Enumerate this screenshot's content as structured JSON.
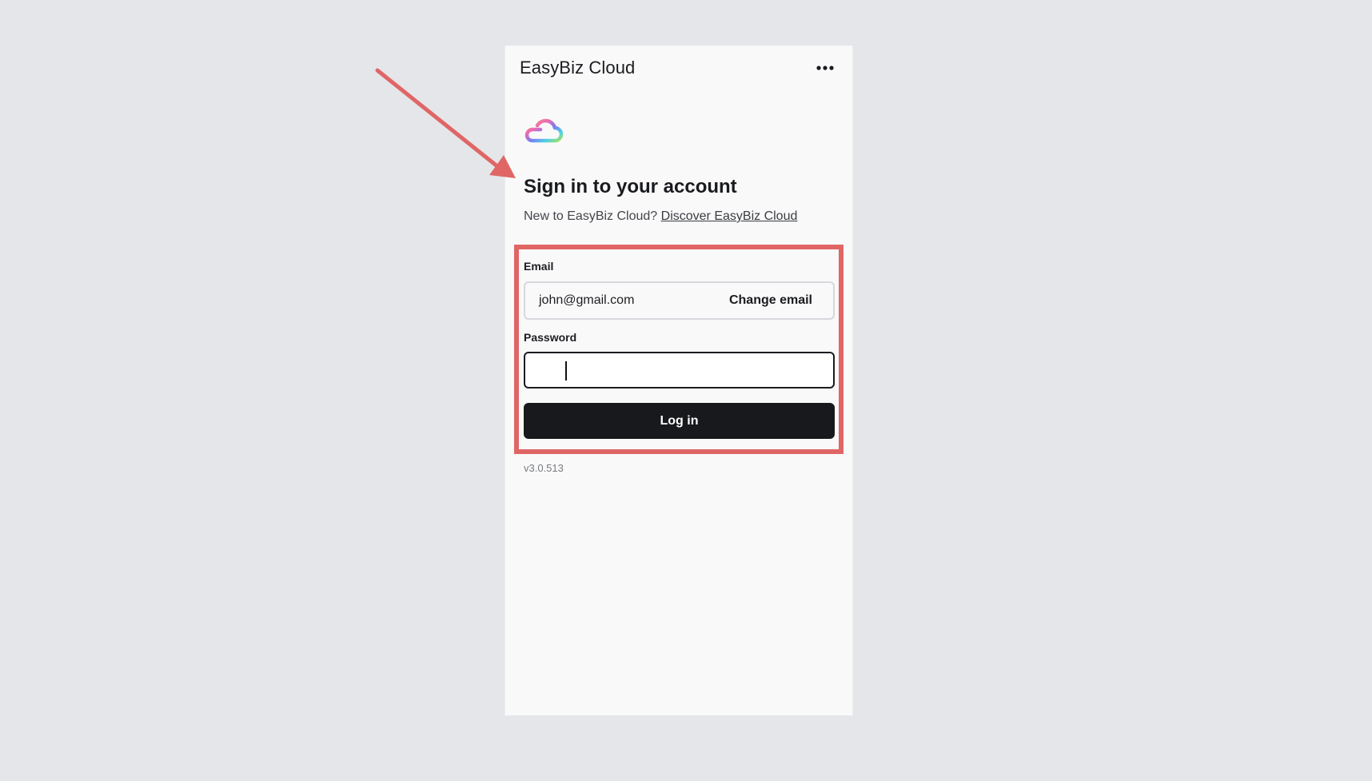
{
  "app": {
    "title": "EasyBiz Cloud",
    "more_icon": "more-horizontal-icon",
    "logo_icon": "cloud-logo-icon"
  },
  "signin": {
    "heading": "Sign in to your account",
    "prompt": "New to EasyBiz Cloud?",
    "discover_link": "Discover EasyBiz Cloud"
  },
  "form": {
    "email_label": "Email",
    "email_value": "john@gmail.com",
    "change_email_label": "Change email",
    "password_label": "Password",
    "password_value": "",
    "login_label": "Log in"
  },
  "footer": {
    "version": "v3.0.513"
  },
  "colors": {
    "page_background": "#e5e6e9",
    "panel_background": "#f9f9f9",
    "highlight": "#e06666",
    "button": "#18191c"
  }
}
